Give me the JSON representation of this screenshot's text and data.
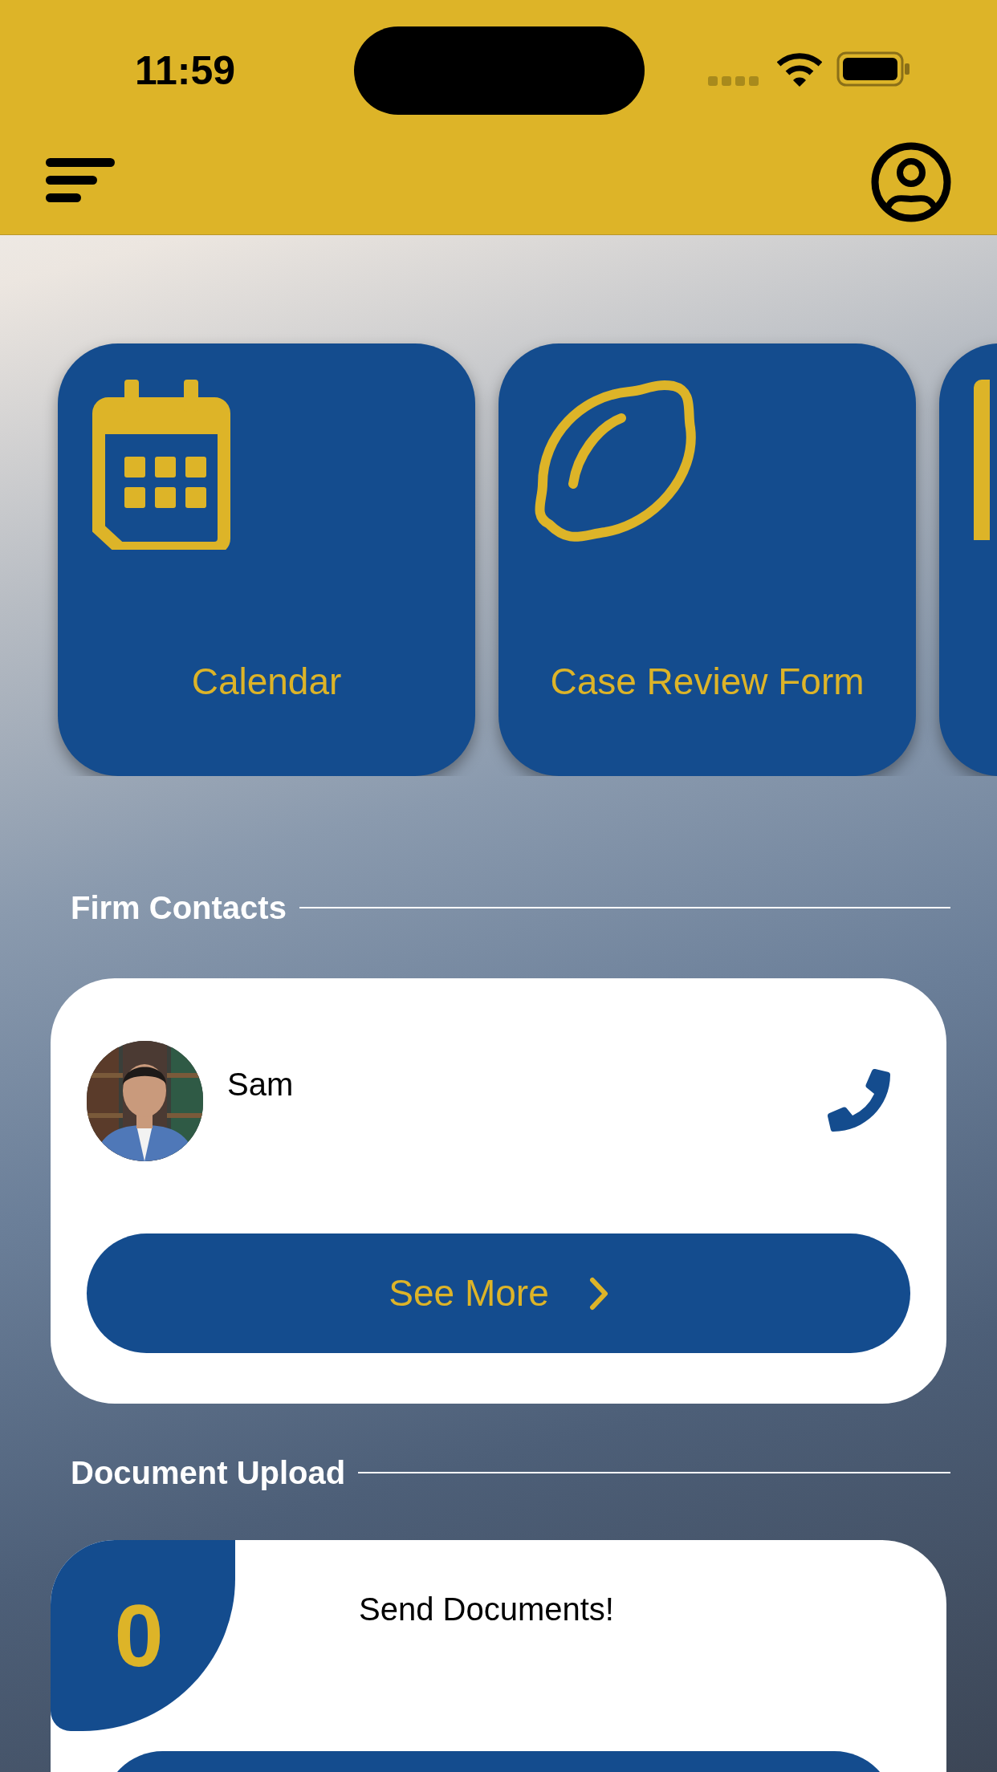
{
  "status_bar": {
    "time": "11:59"
  },
  "tiles": [
    {
      "kind": "calendar",
      "label": "Calendar"
    },
    {
      "kind": "lemon",
      "label": "Case Review Form"
    },
    {
      "kind": "partial"
    }
  ],
  "firm_contacts": {
    "title": "Firm Contacts",
    "contacts": [
      {
        "name": "Sam"
      }
    ],
    "button": "See More"
  },
  "document_upload": {
    "title": "Document Upload",
    "count": "0",
    "message": "Send Documents!"
  }
}
